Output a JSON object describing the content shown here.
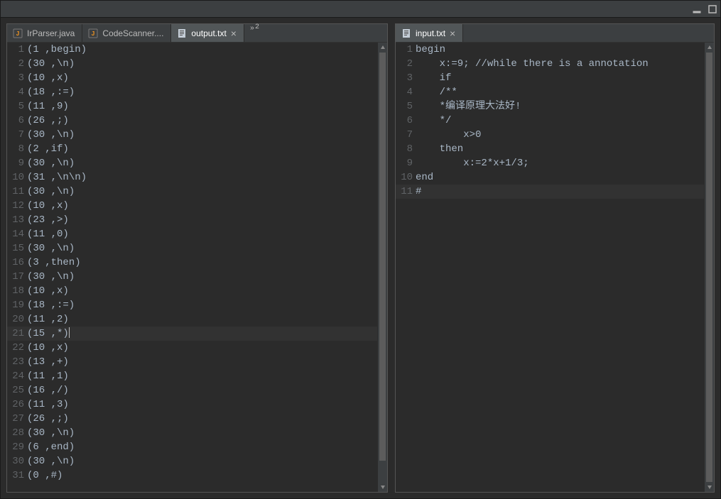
{
  "window": {
    "minimize": "minimize",
    "maximize": "maximize"
  },
  "leftPane": {
    "tabs": [
      {
        "label": "IrParser.java",
        "icon": "java",
        "active": false,
        "closable": false
      },
      {
        "label": "CodeScanner....",
        "icon": "java",
        "active": false,
        "closable": false
      },
      {
        "label": "output.txt",
        "icon": "txt",
        "active": true,
        "closable": true
      }
    ],
    "overflow": {
      "count": "2"
    },
    "currentLine": 21,
    "lines": [
      "(1 ,begin)",
      "(30 ,\\n)",
      "(10 ,x)",
      "(18 ,:=)",
      "(11 ,9)",
      "(26 ,;)",
      "(30 ,\\n)",
      "(2 ,if)",
      "(30 ,\\n)",
      "(31 ,\\n\\n)",
      "(30 ,\\n)",
      "(10 ,x)",
      "(23 ,>)",
      "(11 ,0)",
      "(30 ,\\n)",
      "(3 ,then)",
      "(30 ,\\n)",
      "(10 ,x)",
      "(18 ,:=)",
      "(11 ,2)",
      "(15 ,*)",
      "(10 ,x)",
      "(13 ,+)",
      "(11 ,1)",
      "(16 ,/)",
      "(11 ,3)",
      "(26 ,;)",
      "(30 ,\\n)",
      "(6 ,end)",
      "(30 ,\\n)",
      "(0 ,#)"
    ]
  },
  "rightPane": {
    "tabs": [
      {
        "label": "input.txt",
        "icon": "txt",
        "active": true,
        "closable": true
      }
    ],
    "currentLine": 11,
    "lines": [
      "begin",
      "    x:=9; //while there is a annotation",
      "    if",
      "    /**",
      "    *编译原理大法好!",
      "    */",
      "        x>0",
      "    then",
      "        x:=2*x+1/3;",
      "end",
      "#"
    ]
  }
}
